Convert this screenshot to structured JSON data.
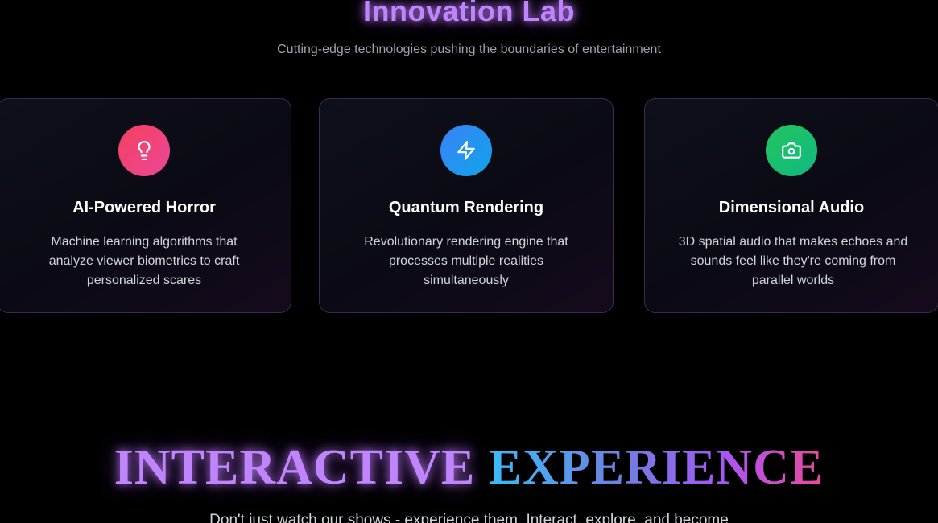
{
  "innovation": {
    "title": "Innovation Lab",
    "subtitle": "Cutting-edge technologies pushing the boundaries of entertainment",
    "cards": [
      {
        "icon": "lightbulb-icon",
        "title": "AI-Powered Horror",
        "description": "Machine learning algorithms that analyze viewer biometrics to craft personalized scares",
        "color": "#f43f5e"
      },
      {
        "icon": "zap-icon",
        "title": "Quantum Rendering",
        "description": "Revolutionary rendering engine that processes multiple realities simultaneously",
        "color": "#3b82f6"
      },
      {
        "icon": "camera-icon",
        "title": "Dimensional Audio",
        "description": "3D spatial audio that makes echoes and sounds feel like they're coming from parallel worlds",
        "color": "#22c55e"
      }
    ]
  },
  "interactive": {
    "title_part1": "INTERACTIVE",
    "title_part2": "EXPERIENCE",
    "subtitle": "Don't just watch our shows - experience them. Interact, explore, and become"
  },
  "colors": {
    "accent_purple": "#c084fc",
    "subtitle_gray": "#9ca3af",
    "card_border": "#3b2a55"
  }
}
